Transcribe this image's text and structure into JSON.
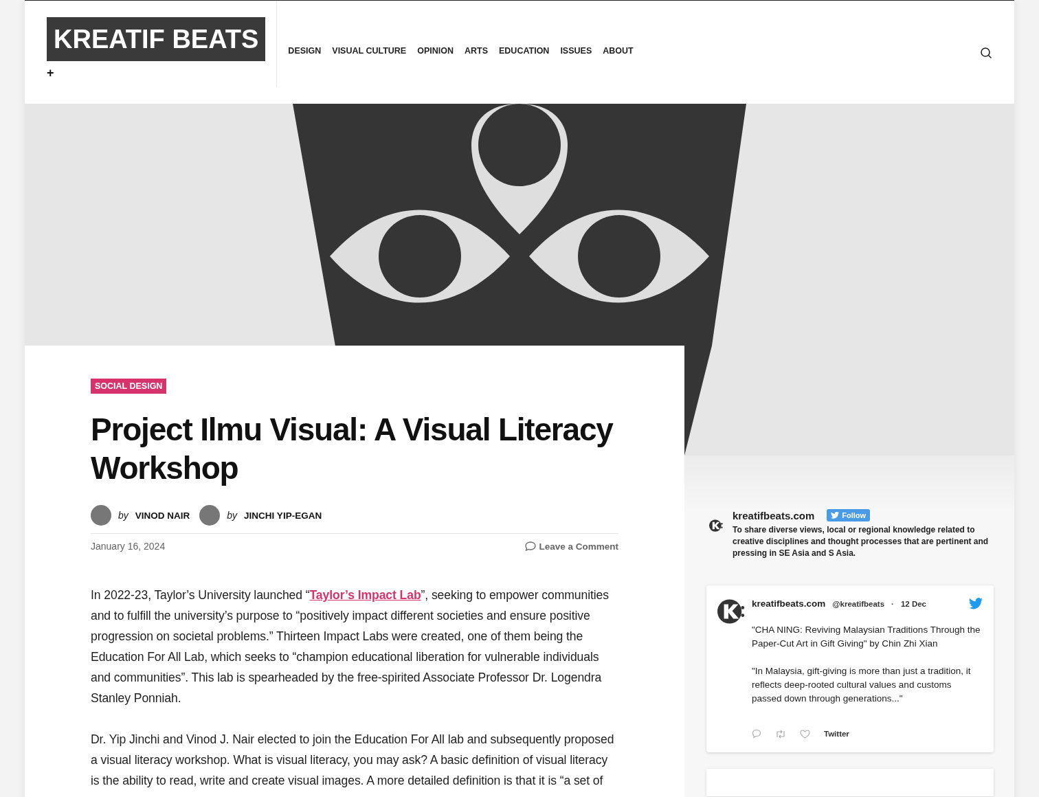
{
  "header": {
    "logo": "KREATIF BEATS",
    "plus": "+",
    "nav": [
      {
        "label": "DESIGN"
      },
      {
        "label": "VISUAL CULTURE"
      },
      {
        "label": "OPINION"
      },
      {
        "label": "ARTS"
      },
      {
        "label": "EDUCATION"
      },
      {
        "label": "ISSUES"
      },
      {
        "label": "ABOUT"
      }
    ]
  },
  "article": {
    "category": "SOCIAL DESIGN",
    "title": "Project Ilmu Visual: A Visual Literacy Workshop",
    "authors": [
      {
        "by": "by",
        "name": "VINOD NAIR"
      },
      {
        "by": "by",
        "name": "JINCHI YIP-EGAN"
      }
    ],
    "date": "January 16, 2024",
    "comment_link": "Leave a Comment",
    "paragraphs": [
      {
        "text": "In 2022-23, Taylor’s University launched “",
        "link": "Taylor’s Impact Lab",
        "after": "”, seeking to empower communities and to fulfill the university’s purpose to “positively impact different societies and ensure positive progression on societal problems.” Thirteen Impact Labs were created, one of them being the Education For All Lab, which seeks to “champion educational liberation for vulnerable individuals and communities”. This lab is spearheaded by the free-spirited Associate Professor Dr. Logendra Stanley Ponniah."
      },
      {
        "text": "Dr. Yip Jinchi and Vinod J. Nair elected to join the Education For All lab and subsequently proposed a visual literacy workshop. What is visual literacy, you may ask? A basic definition of visual literacy is the ability to read, write and create visual images. A more detailed definition is that it is “a set of"
      }
    ]
  },
  "sidebar": {
    "profile": {
      "name": "kreatifbeats.com",
      "follow": "Follow",
      "bio": "To share diverse views, local or regional knowledge related to creative disciplines and thought processes that are pertinent and pressing in SE Asia and S Asia."
    },
    "tweet": {
      "name": "kreatifbeats.com",
      "handle": "@kreatifbeats",
      "dot": "·",
      "date": "12 Dec",
      "paragraphs": [
        "\"CHA NING: Reviving Malaysian Traditions Through the Paper-Cut Art in Gift Giving\" by Chin Zhi Xian",
        "\"In Malaysia, gift-giving is more than just a tradition, it reflects deep-rooted cultural values and customs passed down through generations...\""
      ],
      "source": "Twitter"
    }
  }
}
